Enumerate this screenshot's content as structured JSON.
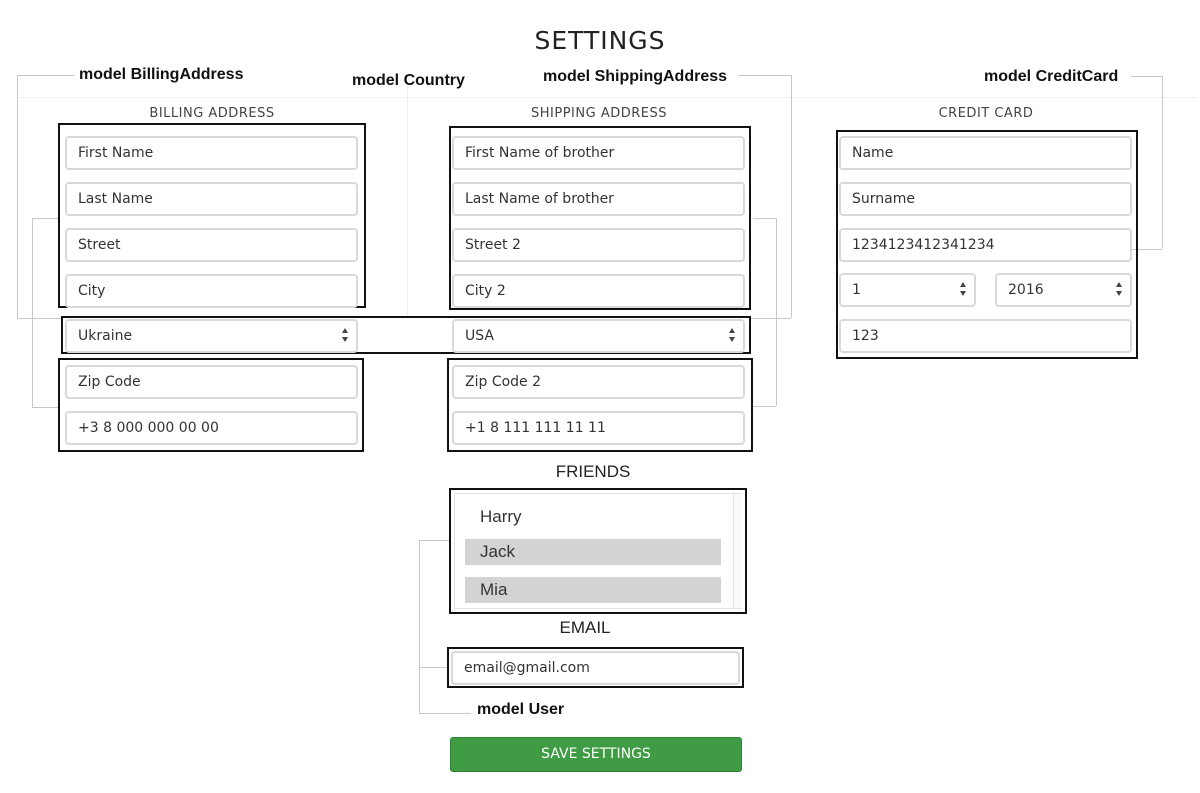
{
  "page_title": "SETTINGS",
  "models": {
    "billing": "model BillingAddress",
    "country": "model Country",
    "shipping": "model ShippingAddress",
    "credit_card": "model CreditCard",
    "user": "model User"
  },
  "billing": {
    "section_label": "BILLING ADDRESS",
    "first_name": "First Name",
    "last_name": "Last Name",
    "street": "Street",
    "city": "City",
    "country": "Ukraine",
    "zip": "Zip Code",
    "phone": "+3 8 000 000 00 00"
  },
  "shipping": {
    "section_label": "SHIPPING ADDRESS",
    "first_name": "First Name of brother",
    "last_name": "Last Name of brother",
    "street": "Street 2",
    "city": "City 2",
    "country": "USA",
    "zip": "Zip Code 2",
    "phone": "+1 8 111 111 11 11"
  },
  "credit_card": {
    "section_label": "CREDIT CARD",
    "name": "Name",
    "surname": "Surname",
    "number": "1234123412341234",
    "month": "1",
    "year": "2016",
    "cvv": "123"
  },
  "friends": {
    "heading": "FRIENDS",
    "items": [
      {
        "label": "Harry",
        "selected": false
      },
      {
        "label": "Jack",
        "selected": true
      },
      {
        "label": "Mia",
        "selected": true
      }
    ]
  },
  "email": {
    "heading": "EMAIL",
    "value": "email@gmail.com"
  },
  "save_button": "SAVE SETTINGS",
  "colors": {
    "save_button": "#3f9c45",
    "selected_item": "#d3d3d3",
    "model_box": "#111111"
  }
}
